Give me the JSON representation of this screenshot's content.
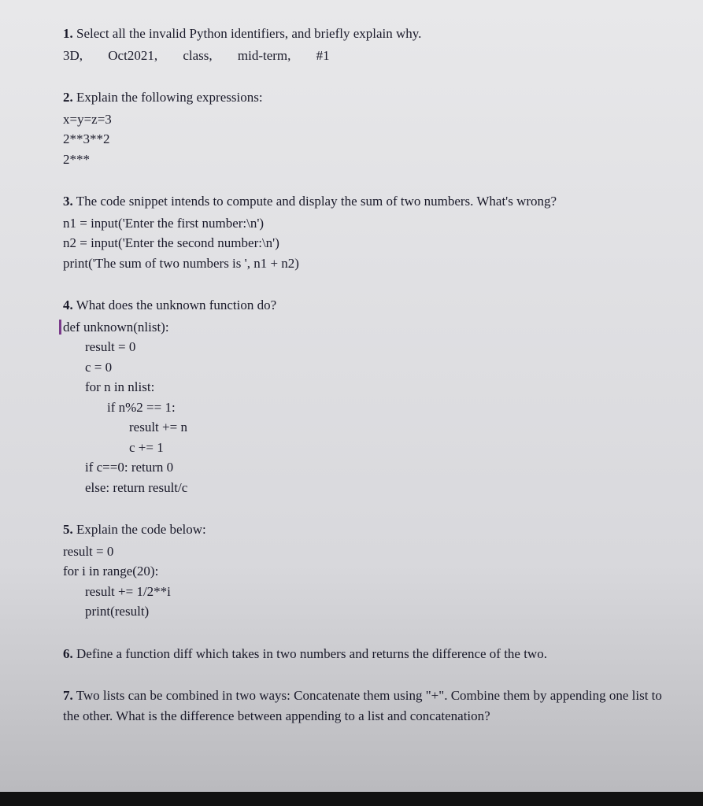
{
  "q1": {
    "prompt_num": "1.",
    "prompt": "Select all the invalid Python identifiers, and briefly explain why.",
    "opts": [
      "3D,",
      "Oct2021,",
      "class,",
      "mid-term,",
      "#1"
    ]
  },
  "q2": {
    "prompt_num": "2.",
    "prompt": "Explain the following expressions:",
    "lines": [
      "x=y=z=3",
      "2**3**2",
      "2***"
    ]
  },
  "q3": {
    "prompt_num": "3.",
    "prompt": "The code snippet intends to compute and display the sum of two numbers. What's wrong?",
    "lines": [
      "n1 = input('Enter the first number:\\n')",
      "n2 = input('Enter the second number:\\n')",
      "print('The sum of two numbers is ', n1 + n2)"
    ]
  },
  "q4": {
    "prompt_num": "4.",
    "prompt": "What does the unknown function do?",
    "def": "def unknown(nlist):",
    "lines": [
      {
        "indent": 1,
        "text": "result = 0"
      },
      {
        "indent": 1,
        "text": "c = 0"
      },
      {
        "indent": 1,
        "text": "for n in nlist:"
      },
      {
        "indent": 2,
        "text": "if n%2 == 1:"
      },
      {
        "indent": 3,
        "text": "result += n"
      },
      {
        "indent": 3,
        "text": "c += 1"
      },
      {
        "indent": 1,
        "text": "if c==0: return 0"
      },
      {
        "indent": 1,
        "text": "else: return result/c"
      }
    ]
  },
  "q5": {
    "prompt_num": "5.",
    "prompt": "Explain the code below:",
    "lines": [
      {
        "indent": 0,
        "text": "result = 0"
      },
      {
        "indent": 0,
        "text": "for i in range(20):"
      },
      {
        "indent": 1,
        "text": "result += 1/2**i"
      },
      {
        "indent": 1,
        "text": "print(result)"
      }
    ]
  },
  "q6": {
    "prompt_num": "6.",
    "prompt": "Define a function diff which takes in two numbers and returns the difference of the two."
  },
  "q7": {
    "prompt_num": "7.",
    "prompt": "Two lists can be combined in two ways: Concatenate them using \"+\". Combine them by appending one list to the other. What is the difference between appending to a list and concatenation?"
  }
}
